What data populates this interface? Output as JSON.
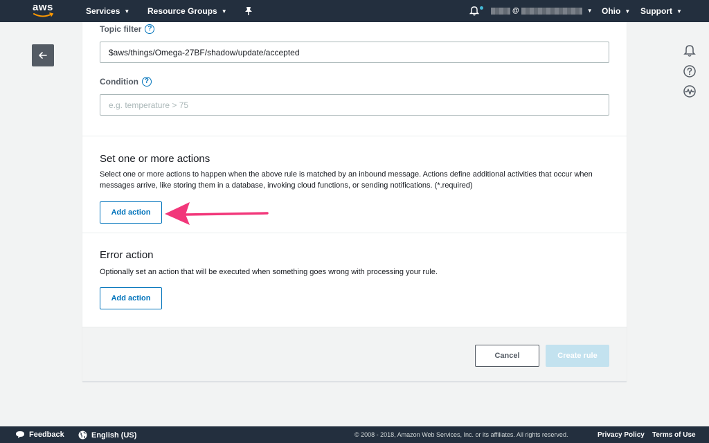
{
  "topnav": {
    "logo": "aws",
    "services_label": "Services",
    "resource_groups_label": "Resource Groups",
    "account_at": "@",
    "region_label": "Ohio",
    "support_label": "Support"
  },
  "rule": {
    "topic_filter_label": "Topic filter",
    "topic_filter_value": "$aws/things/Omega-27BF/shadow/update/accepted",
    "condition_label": "Condition",
    "condition_placeholder": "e.g. temperature > 75"
  },
  "actions": {
    "title": "Set one or more actions",
    "description": "Select one or more actions to happen when the above rule is matched by an inbound message. Actions define additional activities that occur when messages arrive, like storing them in a database, invoking cloud functions, or sending notifications. (*.required)",
    "add_action_label": "Add action"
  },
  "error_action": {
    "title": "Error action",
    "description": "Optionally set an action that will be executed when something goes wrong with processing your rule.",
    "add_action_label": "Add action"
  },
  "form_footer": {
    "cancel_label": "Cancel",
    "create_label": "Create rule"
  },
  "bottombar": {
    "feedback_label": "Feedback",
    "language_label": "English (US)",
    "copyright": "© 2008 - 2018, Amazon Web Services, Inc. or its affiliates. All rights reserved.",
    "privacy_label": "Privacy Policy",
    "terms_label": "Terms of Use"
  },
  "colors": {
    "nav_bg": "#232f3e",
    "accent": "#0073bb",
    "annotation_arrow": "#f2377a",
    "disabled_primary": "#c3e2ef"
  }
}
